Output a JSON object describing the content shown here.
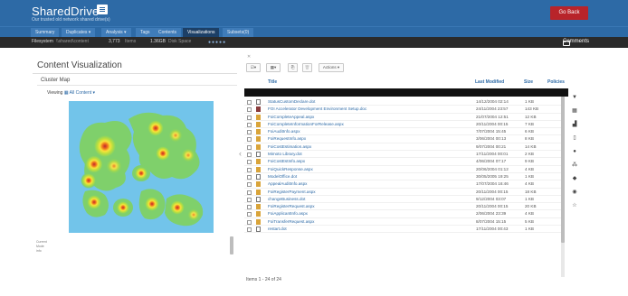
{
  "app": {
    "title": "SharedDrive",
    "subtitle": "Our trusted old network shared drive(s)",
    "go_back_label": "Go Back",
    "menu_icon": "hamburger-icon"
  },
  "tabs": [
    {
      "label": "Summary",
      "active": false
    },
    {
      "label": "Duplicates ▾",
      "active": false
    },
    {
      "label": "Analysis ▾",
      "active": false
    },
    {
      "label": "Tags",
      "active": false
    },
    {
      "label": "Contents",
      "active": false
    },
    {
      "label": "Visualizations",
      "active": true
    },
    {
      "label": "Subsets(0)",
      "active": false
    }
  ],
  "infobar": {
    "filesystem_label": "Filesystem",
    "filesystem_value": "\\\\shared\\content",
    "items_value": "3,773",
    "items_label": "Items",
    "space_value": "1.36GB",
    "space_label": "Disk Space",
    "progress_dots": "●●●●●",
    "comments_label": "Comments"
  },
  "left_panel": {
    "title": "Content Visualization",
    "cluster_title": "Cluster Map",
    "viewing_label": "Viewing",
    "viewing_value": "All Content ▾",
    "legend_lines": [
      "Current",
      "Mode",
      "info"
    ]
  },
  "toolbar": {
    "close_label": "✕",
    "btn_select": "☑▾",
    "btn_view": "▦▾",
    "btn_export": "⎘",
    "btn_delete": "🗑",
    "btn_actions": "Actions ▾"
  },
  "grid": {
    "columns": [
      "Title",
      "Last Modified",
      "Size",
      "Policies"
    ],
    "rows": [
      {
        "icon": "plain",
        "title": "StatusCustomDeclare.dot",
        "modified": "14/12/2004 02:14",
        "size": "1 KB"
      },
      {
        "icon": "img",
        "title": "FOI Accelerator Development Environment Setup.doc",
        "modified": "24/11/2004 23:57",
        "size": "143 KB"
      },
      {
        "icon": "doc",
        "title": "FoiCompleteAppeal.aspx",
        "modified": "21/07/2004 12:51",
        "size": "12 KB"
      },
      {
        "icon": "doc",
        "title": "FoiCompleteInformationForRelease.aspx",
        "modified": "20/11/2004 00:15",
        "size": "7 KB"
      },
      {
        "icon": "doc",
        "title": "FoiAuditInfo.aspx",
        "modified": "7/07/2004 15:45",
        "size": "6 KB"
      },
      {
        "icon": "doc",
        "title": "FoiRequestInfo.aspx",
        "modified": "3/06/2004 00:13",
        "size": "8 KB"
      },
      {
        "icon": "doc",
        "title": "FoiCostEstimation.aspx",
        "modified": "9/07/2004 00:21",
        "size": "14 KB"
      },
      {
        "icon": "plain",
        "title": "Mimoto Library.dot",
        "modified": "17/11/2004 00:01",
        "size": "2 KB"
      },
      {
        "icon": "doc",
        "title": "FoiCostEstInfo.aspx",
        "modified": "4/06/2004 07:17",
        "size": "9 KB"
      },
      {
        "icon": "doc",
        "title": "FoiQuickResponse.aspx",
        "modified": "20/06/2004 01:12",
        "size": "4 KB"
      },
      {
        "icon": "plain",
        "title": "ModelOffice.dot",
        "modified": "30/05/2005 19:25",
        "size": "1 KB"
      },
      {
        "icon": "doc",
        "title": "AppealAuditInfo.aspx",
        "modified": "17/07/2004 16:46",
        "size": "4 KB"
      },
      {
        "icon": "doc",
        "title": "FoiRegisterPayment.aspx",
        "modified": "20/11/2004 00:15",
        "size": "18 KB"
      },
      {
        "icon": "plain",
        "title": "changeBusiness.dot",
        "modified": "9/12/2004 03:07",
        "size": "1 KB"
      },
      {
        "icon": "doc",
        "title": "FoiRegisterRequest.aspx",
        "modified": "20/11/2004 00:15",
        "size": "20 KB"
      },
      {
        "icon": "doc",
        "title": "FoiApplicantInfo.aspx",
        "modified": "2/06/2004 23:39",
        "size": "4 KB"
      },
      {
        "icon": "doc",
        "title": "FoiTransferRequest.aspx",
        "modified": "8/07/2004 15:15",
        "size": "5 KB"
      },
      {
        "icon": "plain",
        "title": "restart.dot",
        "modified": "17/11/2004 00:43",
        "size": "1 KB"
      }
    ],
    "items_count": "Items 1 - 24 of 24"
  },
  "side_icons": [
    "filter-icon",
    "calendar-icon",
    "bar-chart-icon",
    "document-icon",
    "user-icon",
    "group-icon",
    "tag-icon",
    "record-icon",
    "star-icon"
  ],
  "colors": {
    "header_bg": "#2d6aa6",
    "active_tab_bg": "#1c3f66",
    "infobar_bg": "#2a2a2a",
    "go_back_bg": "#b8242a",
    "link": "#2d6aa6",
    "heatmap_base": "#72c4ea"
  }
}
